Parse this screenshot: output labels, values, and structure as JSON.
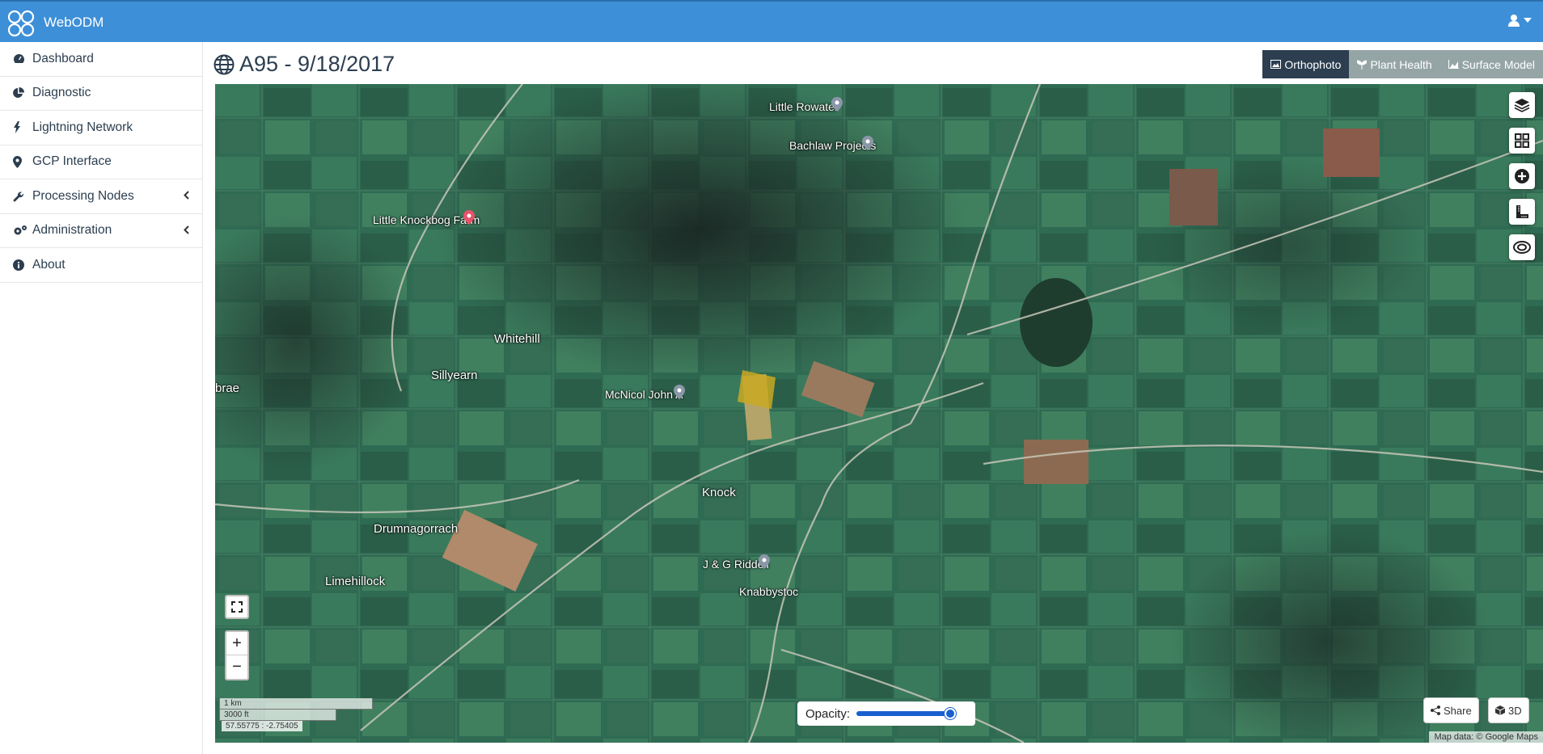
{
  "app": {
    "brand": "WebODM"
  },
  "sidebar": {
    "items": [
      {
        "label": "Dashboard",
        "icon": "dashboard-icon"
      },
      {
        "label": "Diagnostic",
        "icon": "pie-chart-icon"
      },
      {
        "label": "Lightning Network",
        "icon": "bolt-icon"
      },
      {
        "label": "GCP Interface",
        "icon": "map-marker-icon"
      },
      {
        "label": "Processing Nodes",
        "icon": "wrench-icon",
        "expandable": true
      },
      {
        "label": "Administration",
        "icon": "gears-icon",
        "expandable": true
      },
      {
        "label": "About",
        "icon": "info-icon"
      }
    ]
  },
  "page": {
    "title": "A95 - 9/18/2017"
  },
  "view_tabs": [
    {
      "label": "Orthophoto",
      "active": true
    },
    {
      "label": "Plant Health",
      "active": false
    },
    {
      "label": "Surface Model",
      "active": false
    }
  ],
  "map": {
    "places": {
      "little_rowater": "Little Rowater",
      "bachlaw": "Bachlaw Projects",
      "knockbog": "Little Knockbog Farm",
      "whitehill": "Whitehill",
      "sillyearn": "Sillyearn",
      "brae": "brae",
      "mcnicol": "McNicol John A",
      "knock": "Knock",
      "drumnagorrach": "Drumnagorrach",
      "riddell": "J & G Riddell",
      "limehillock": "Limehillock",
      "knockbystoc": "Knabbystoc"
    },
    "scale_km": "1 km",
    "scale_ft": "3000 ft",
    "coordinates": "57.55775 : -2.75405",
    "opacity_label": "Opacity:",
    "opacity_value": 0.95,
    "share_label": "Share",
    "threed_label": "3D",
    "attribution": "Map data: © Google Maps",
    "zoom_in": "+",
    "zoom_out": "−"
  },
  "colors": {
    "topbar": "#3d8fd8",
    "active_tab": "#2c3e50",
    "inactive_tab": "#95a5a6",
    "text": "#2c3e50"
  }
}
